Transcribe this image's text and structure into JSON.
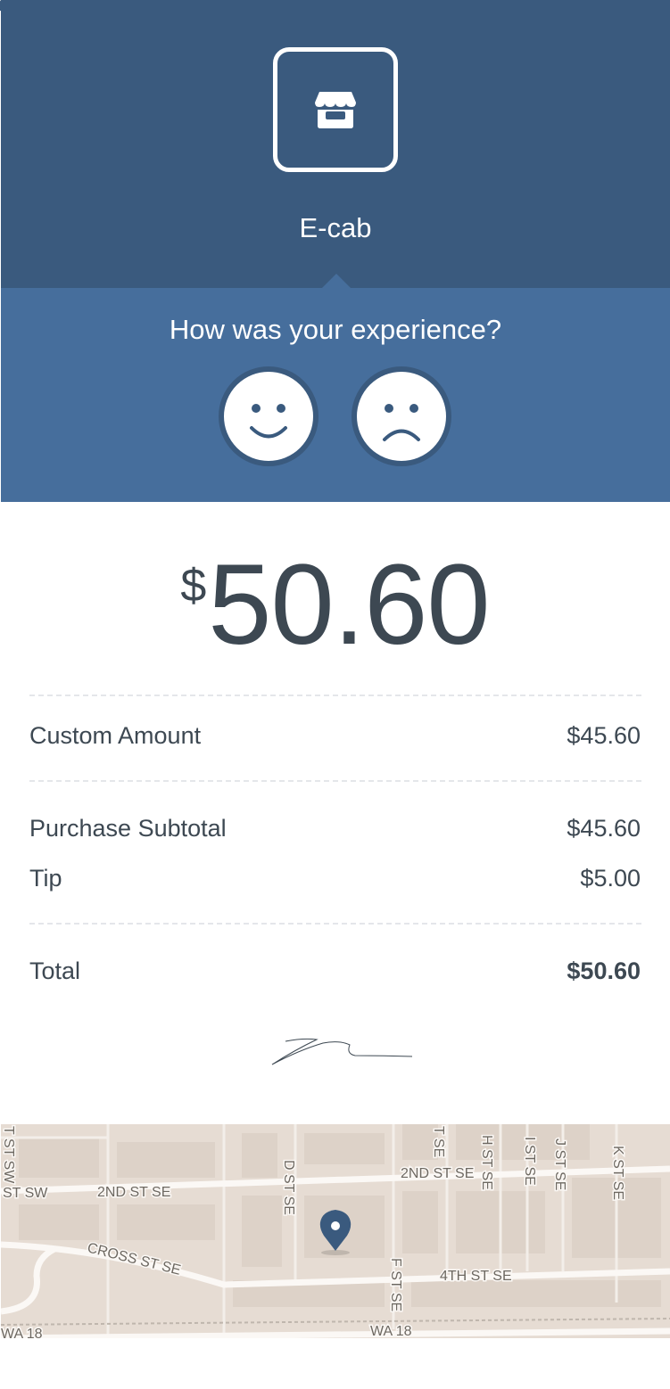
{
  "merchant": {
    "name": "E-cab",
    "logo_icon": "storefront-icon"
  },
  "feedback": {
    "question": "How was your experience?",
    "positive_icon": "smiley-face-icon",
    "negative_icon": "sad-face-icon"
  },
  "amount": {
    "currency_symbol": "$",
    "value": "50.60"
  },
  "line_items": [
    {
      "label": "Custom Amount",
      "value": "$45.60"
    }
  ],
  "summary": [
    {
      "label": "Purchase Subtotal",
      "value": "$45.60"
    },
    {
      "label": "Tip",
      "value": "$5.00"
    }
  ],
  "total": {
    "label": "Total",
    "value": "$50.60"
  },
  "map": {
    "street_labels": [
      "T ST SW",
      "ST SW",
      "2ND ST SE",
      "CROSS ST SE",
      "D ST SE",
      "2ND ST SE",
      "T SE",
      "H ST SE",
      "I ST SE",
      "J ST SE",
      "K ST SE",
      "F ST SE",
      "4TH ST SE",
      "WA 18",
      "WA 18"
    ],
    "marker_icon": "map-pin-icon"
  },
  "colors": {
    "header": "#3a5a7e",
    "feedback": "#466e9c",
    "text": "#3d4852",
    "map_bg": "#e6dcd3"
  }
}
